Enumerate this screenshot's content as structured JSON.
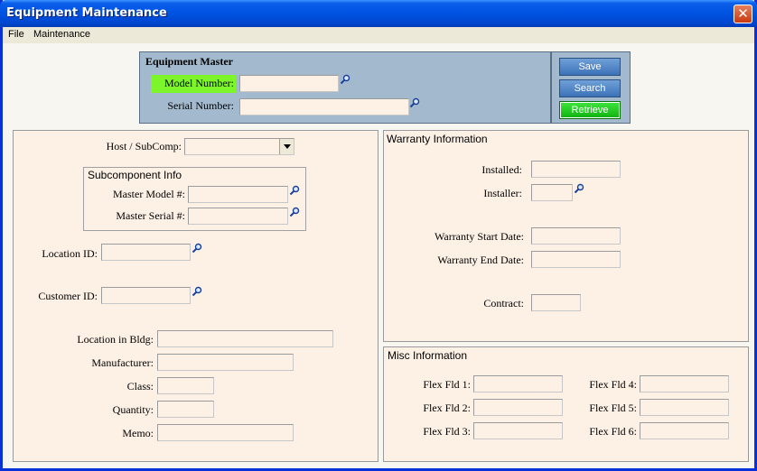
{
  "window": {
    "title": "Equipment Maintenance",
    "close_glyph": "✕"
  },
  "menu": {
    "items": [
      "File",
      "Maintenance"
    ]
  },
  "equipment_master": {
    "title": "Equipment Master",
    "model_label": "Model Number:",
    "model_value": "",
    "serial_label": "Serial Number:",
    "serial_value": "",
    "highlight_color": "#7cf52a"
  },
  "buttons": {
    "save": "Save",
    "search": "Search",
    "retrieve": "Retrieve"
  },
  "left": {
    "host_label": "Host / SubComp:",
    "host_value": "",
    "subcomp_title": "Subcomponent Info",
    "master_model_label": "Master Model #:",
    "master_serial_label": "Master Serial #:",
    "location_id_label": "Location ID:",
    "customer_id_label": "Customer ID:",
    "location_bldg_label": "Location in Bldg:",
    "manufacturer_label": "Manufacturer:",
    "class_label": "Class:",
    "quantity_label": "Quantity:",
    "memo_label": "Memo:"
  },
  "warranty": {
    "title": "Warranty Information",
    "installed_label": "Installed:",
    "installer_label": "Installer:",
    "start_label": "Warranty Start Date:",
    "end_label": "Warranty End Date:",
    "contract_label": "Contract:"
  },
  "misc": {
    "title": "Misc Information",
    "flex1": "Flex Fld 1:",
    "flex2": "Flex Fld 2:",
    "flex3": "Flex Fld 3:",
    "flex4": "Flex Fld 4:",
    "flex5": "Flex Fld 5:",
    "flex6": "Flex Fld 6:"
  },
  "icons": {
    "lookup": "magnifier-icon",
    "dropdown": "chevron-down-icon"
  }
}
